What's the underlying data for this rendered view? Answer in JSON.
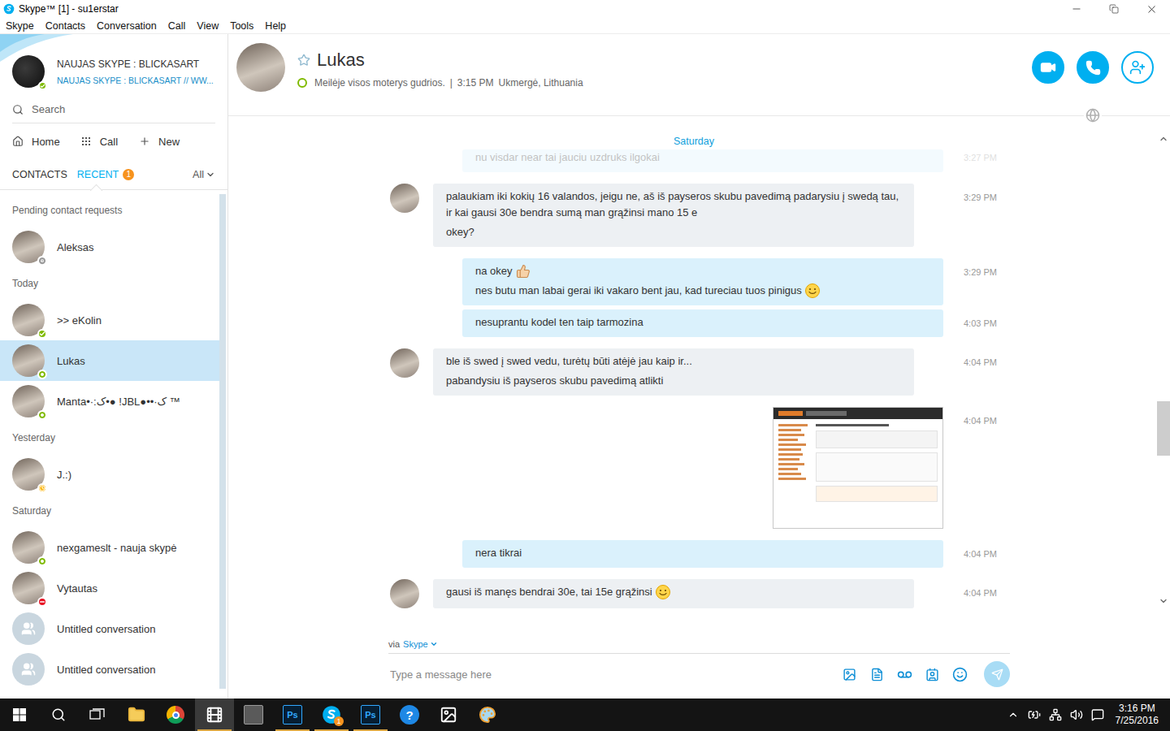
{
  "window": {
    "title": "Skype™ [1] - su1erstar"
  },
  "menu": [
    "Skype",
    "Contacts",
    "Conversation",
    "Call",
    "View",
    "Tools",
    "Help"
  ],
  "profile": {
    "name": "NAUJAS SKYPE : BLICKASART",
    "mood": "NAUJAS SKYPE : BLICKASART // WW...",
    "status": "online",
    "color": "#7fba00"
  },
  "search": {
    "placeholder": "Search"
  },
  "nav": [
    {
      "kind": "home",
      "label": "Home"
    },
    {
      "kind": "dialpad",
      "label": "Call"
    },
    {
      "kind": "new",
      "label": "New"
    }
  ],
  "list_tabs": [
    {
      "label": "CONTACTS",
      "selected": false,
      "badge": ""
    },
    {
      "label": "RECENT",
      "selected": true,
      "badge": "1"
    }
  ],
  "filter": {
    "label": "All"
  },
  "sidebar": {
    "scrollbar": {
      "offset": 0,
      "level": 0.98
    },
    "sections": [
      {
        "header": "Pending contact requests",
        "items": [
          {
            "name": "Aleksas",
            "kind": "person",
            "status": "pending",
            "color": "#9a9a9a",
            "selected": false
          }
        ]
      },
      {
        "header": "Today",
        "items": [
          {
            "name": ">> eKolin",
            "kind": "person",
            "status": "online",
            "color": "#7fba00",
            "selected": false
          },
          {
            "name": "Lukas",
            "kind": "person",
            "status": "mobile",
            "color": "#7fba00",
            "selected": true
          },
          {
            "name": "Manta•·:ک•● !JBL●••·ک ™",
            "kind": "person",
            "status": "mobile",
            "color": "#7fba00",
            "selected": false
          }
        ]
      },
      {
        "header": "Yesterday",
        "items": [
          {
            "name": "J.:)",
            "kind": "person",
            "status": "away",
            "color": "#fdb813",
            "selected": false
          }
        ]
      },
      {
        "header": "Saturday",
        "items": [
          {
            "name": "nexgameslt - nauja skypė",
            "kind": "person",
            "status": "mobile",
            "color": "#7fba00",
            "selected": false
          },
          {
            "name": "Vytautas",
            "kind": "person",
            "status": "busy",
            "color": "#e81123",
            "selected": false
          },
          {
            "name": "Untitled conversation",
            "kind": "group",
            "status": "none",
            "color": "#ffffff",
            "selected": false
          },
          {
            "name": "Untitled conversation",
            "kind": "group",
            "status": "none",
            "color": "#ffffff",
            "selected": false
          }
        ]
      }
    ]
  },
  "conversation": {
    "name": "Lukas",
    "favorite": false,
    "status": "mobile",
    "color": "#7fba00",
    "mood": "Meilėje visos moterys gudrios.",
    "separator": "|",
    "local_time": "3:15 PM",
    "location": "Ukmergė, Lithuania"
  },
  "date_label": "Saturday",
  "messages": [
    {
      "from": "me",
      "kind": "text",
      "faded": true,
      "lines": [
        {
          "text": "nu visdar near tai jauciu uzdruks ilgokai",
          "emoticon": ""
        }
      ],
      "time": "3:27 PM"
    },
    {
      "from": "them",
      "kind": "text",
      "faded": false,
      "lines": [
        {
          "text": "palaukiam iki kokių 16 valandos, jeigu ne, aš iš payseros skubu pavedimą padarysiu į swedą tau, ir kai gausi 30e bendra sumą man grąžinsi mano 15 e",
          "emoticon": ""
        },
        {
          "text": "okey?",
          "emoticon": ""
        }
      ],
      "time": "3:29 PM"
    },
    {
      "from": "me",
      "kind": "text",
      "faded": false,
      "lines": [
        {
          "text": "na okey",
          "emoticon": "thumbs-up"
        },
        {
          "text": "nes butu man labai gerai iki vakaro bent jau, kad tureciau tuos pinigus",
          "emoticon": "smile"
        }
      ],
      "time": "3:29 PM"
    },
    {
      "from": "me",
      "kind": "text",
      "faded": false,
      "lines": [
        {
          "text": "nesuprantu kodel ten taip tarmozina",
          "emoticon": ""
        }
      ],
      "time": "4:03 PM"
    },
    {
      "from": "them",
      "kind": "text",
      "faded": false,
      "lines": [
        {
          "text": "ble iš swed į swed vedu, turėtų būti atėjė jau kaip ir...",
          "emoticon": ""
        },
        {
          "text": "pabandysiu iš payseros skubu pavedimą atlikti",
          "emoticon": ""
        }
      ],
      "time": "4:04 PM"
    },
    {
      "from": "me",
      "kind": "image",
      "faded": false,
      "lines": [],
      "time": "4:04 PM"
    },
    {
      "from": "me",
      "kind": "text",
      "faded": false,
      "lines": [
        {
          "text": "nera tikrai",
          "emoticon": ""
        }
      ],
      "time": "4:04 PM"
    },
    {
      "from": "them",
      "kind": "text",
      "faded": false,
      "lines": [
        {
          "text": "gausi iš manęs bendrai 30e, tai 15e grąžinsi",
          "emoticon": "smile"
        }
      ],
      "time": "4:04 PM"
    }
  ],
  "chat_scrollbar": {
    "offset": 0.57,
    "level": 0.12
  },
  "composer": {
    "via": "via",
    "network": "Skype",
    "placeholder": "Type a message here"
  },
  "taskbar": {
    "apps": [
      {
        "kind": "explorer",
        "label": "",
        "badge": "",
        "running": false,
        "selected": false
      },
      {
        "kind": "chrome",
        "label": "",
        "badge": "",
        "running": false,
        "selected": false
      },
      {
        "kind": "video-editor",
        "label": "",
        "badge": "",
        "running": true,
        "selected": true
      },
      {
        "kind": "app",
        "label": "",
        "badge": "",
        "running": false,
        "selected": false
      },
      {
        "kind": "photoshop",
        "label": "Ps",
        "badge": "",
        "running": true,
        "selected": false
      },
      {
        "kind": "skype",
        "label": "",
        "badge": "1",
        "running": true,
        "selected": false
      },
      {
        "kind": "photoshop",
        "label": "Ps",
        "badge": "",
        "running": true,
        "selected": false
      },
      {
        "kind": "help",
        "label": "?",
        "badge": "",
        "running": false,
        "selected": false
      },
      {
        "kind": "photos",
        "label": "",
        "badge": "",
        "running": false,
        "selected": false
      },
      {
        "kind": "paint",
        "label": "",
        "badge": "",
        "running": false,
        "selected": false
      }
    ],
    "clock": {
      "time": "3:16 PM",
      "date": "7/25/2016"
    }
  }
}
